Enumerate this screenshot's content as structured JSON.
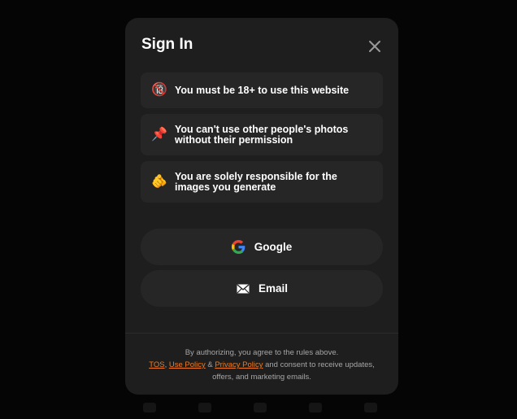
{
  "modal": {
    "title": "Sign In",
    "rules": [
      {
        "emoji": "🔞",
        "text": "You must be 18+ to use this website"
      },
      {
        "emoji": "📌",
        "text": "You can't use other people's photos without their permission"
      },
      {
        "emoji": "🫵",
        "text": "You are solely responsible for the images you generate"
      }
    ],
    "buttons": {
      "google_label": "Google",
      "email_label": "Email"
    },
    "footer": {
      "line1": "By authorizing, you agree to the rules above.",
      "tos": "TOS",
      "sep1": ", ",
      "use_policy": "Use Policy",
      "sep2": " & ",
      "privacy_policy": "Privacy Policy",
      "tail": " and consent to receive updates, offers, and marketing emails."
    }
  },
  "colors": {
    "modal_bg": "#1e1e1e",
    "card_bg": "#262626",
    "link": "#f07b22"
  },
  "icons": {
    "close": "close-icon",
    "google": "google-icon",
    "email": "mail-icon"
  }
}
